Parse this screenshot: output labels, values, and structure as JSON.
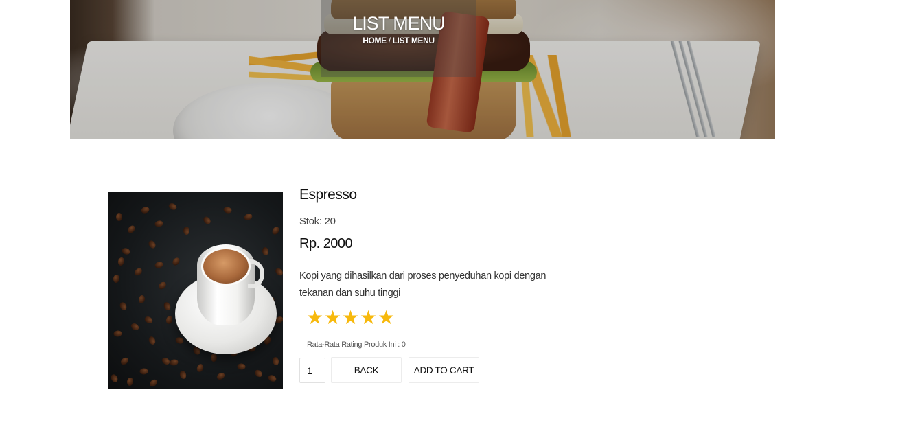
{
  "hero": {
    "title": "LIST MENU",
    "breadcrumb": [
      {
        "label": "HOME"
      },
      {
        "label": "LIST MENU"
      }
    ],
    "breadcrumb_separator": "/"
  },
  "product": {
    "name": "Espresso",
    "stock_label": "Stok:",
    "stock_value": "20",
    "price_currency": "Rp.",
    "price_value": "2000",
    "description": "Kopi yang dihasilkan dari proses penyeduhan kopi dengan tekanan dan suhu tinggi",
    "rating": {
      "stars_total": 5,
      "stars_filled": 5,
      "star_glyph": "★",
      "star_color": "#f7b90d",
      "average_label": "Rata-Rata Rating Produk Ini :",
      "average_value": "0"
    }
  },
  "actions": {
    "quantity": "1",
    "back_label": "BACK",
    "add_to_cart_label": "ADD TO CART"
  }
}
